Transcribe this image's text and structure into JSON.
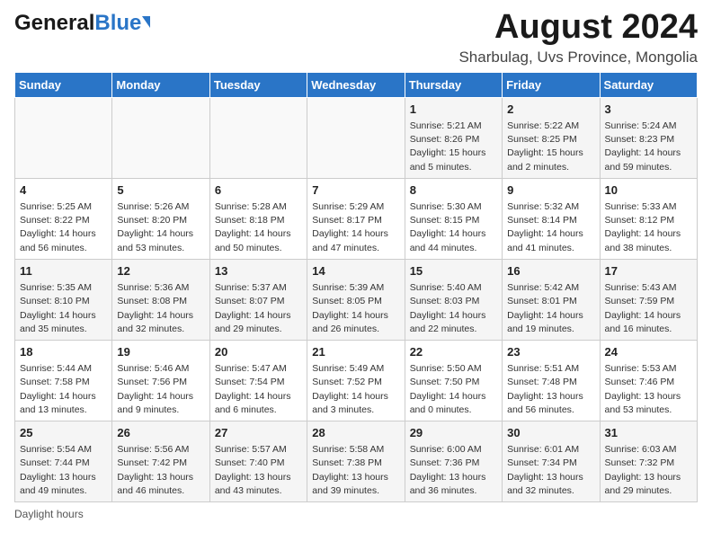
{
  "header": {
    "logo_general": "General",
    "logo_blue": "Blue",
    "title": "August 2024",
    "subtitle": "Sharbulag, Uvs Province, Mongolia"
  },
  "calendar": {
    "weekdays": [
      "Sunday",
      "Monday",
      "Tuesday",
      "Wednesday",
      "Thursday",
      "Friday",
      "Saturday"
    ],
    "weeks": [
      [
        {
          "day": "",
          "info": ""
        },
        {
          "day": "",
          "info": ""
        },
        {
          "day": "",
          "info": ""
        },
        {
          "day": "",
          "info": ""
        },
        {
          "day": "1",
          "info": "Sunrise: 5:21 AM\nSunset: 8:26 PM\nDaylight: 15 hours\nand 5 minutes."
        },
        {
          "day": "2",
          "info": "Sunrise: 5:22 AM\nSunset: 8:25 PM\nDaylight: 15 hours\nand 2 minutes."
        },
        {
          "day": "3",
          "info": "Sunrise: 5:24 AM\nSunset: 8:23 PM\nDaylight: 14 hours\nand 59 minutes."
        }
      ],
      [
        {
          "day": "4",
          "info": "Sunrise: 5:25 AM\nSunset: 8:22 PM\nDaylight: 14 hours\nand 56 minutes."
        },
        {
          "day": "5",
          "info": "Sunrise: 5:26 AM\nSunset: 8:20 PM\nDaylight: 14 hours\nand 53 minutes."
        },
        {
          "day": "6",
          "info": "Sunrise: 5:28 AM\nSunset: 8:18 PM\nDaylight: 14 hours\nand 50 minutes."
        },
        {
          "day": "7",
          "info": "Sunrise: 5:29 AM\nSunset: 8:17 PM\nDaylight: 14 hours\nand 47 minutes."
        },
        {
          "day": "8",
          "info": "Sunrise: 5:30 AM\nSunset: 8:15 PM\nDaylight: 14 hours\nand 44 minutes."
        },
        {
          "day": "9",
          "info": "Sunrise: 5:32 AM\nSunset: 8:14 PM\nDaylight: 14 hours\nand 41 minutes."
        },
        {
          "day": "10",
          "info": "Sunrise: 5:33 AM\nSunset: 8:12 PM\nDaylight: 14 hours\nand 38 minutes."
        }
      ],
      [
        {
          "day": "11",
          "info": "Sunrise: 5:35 AM\nSunset: 8:10 PM\nDaylight: 14 hours\nand 35 minutes."
        },
        {
          "day": "12",
          "info": "Sunrise: 5:36 AM\nSunset: 8:08 PM\nDaylight: 14 hours\nand 32 minutes."
        },
        {
          "day": "13",
          "info": "Sunrise: 5:37 AM\nSunset: 8:07 PM\nDaylight: 14 hours\nand 29 minutes."
        },
        {
          "day": "14",
          "info": "Sunrise: 5:39 AM\nSunset: 8:05 PM\nDaylight: 14 hours\nand 26 minutes."
        },
        {
          "day": "15",
          "info": "Sunrise: 5:40 AM\nSunset: 8:03 PM\nDaylight: 14 hours\nand 22 minutes."
        },
        {
          "day": "16",
          "info": "Sunrise: 5:42 AM\nSunset: 8:01 PM\nDaylight: 14 hours\nand 19 minutes."
        },
        {
          "day": "17",
          "info": "Sunrise: 5:43 AM\nSunset: 7:59 PM\nDaylight: 14 hours\nand 16 minutes."
        }
      ],
      [
        {
          "day": "18",
          "info": "Sunrise: 5:44 AM\nSunset: 7:58 PM\nDaylight: 14 hours\nand 13 minutes."
        },
        {
          "day": "19",
          "info": "Sunrise: 5:46 AM\nSunset: 7:56 PM\nDaylight: 14 hours\nand 9 minutes."
        },
        {
          "day": "20",
          "info": "Sunrise: 5:47 AM\nSunset: 7:54 PM\nDaylight: 14 hours\nand 6 minutes."
        },
        {
          "day": "21",
          "info": "Sunrise: 5:49 AM\nSunset: 7:52 PM\nDaylight: 14 hours\nand 3 minutes."
        },
        {
          "day": "22",
          "info": "Sunrise: 5:50 AM\nSunset: 7:50 PM\nDaylight: 14 hours\nand 0 minutes."
        },
        {
          "day": "23",
          "info": "Sunrise: 5:51 AM\nSunset: 7:48 PM\nDaylight: 13 hours\nand 56 minutes."
        },
        {
          "day": "24",
          "info": "Sunrise: 5:53 AM\nSunset: 7:46 PM\nDaylight: 13 hours\nand 53 minutes."
        }
      ],
      [
        {
          "day": "25",
          "info": "Sunrise: 5:54 AM\nSunset: 7:44 PM\nDaylight: 13 hours\nand 49 minutes."
        },
        {
          "day": "26",
          "info": "Sunrise: 5:56 AM\nSunset: 7:42 PM\nDaylight: 13 hours\nand 46 minutes."
        },
        {
          "day": "27",
          "info": "Sunrise: 5:57 AM\nSunset: 7:40 PM\nDaylight: 13 hours\nand 43 minutes."
        },
        {
          "day": "28",
          "info": "Sunrise: 5:58 AM\nSunset: 7:38 PM\nDaylight: 13 hours\nand 39 minutes."
        },
        {
          "day": "29",
          "info": "Sunrise: 6:00 AM\nSunset: 7:36 PM\nDaylight: 13 hours\nand 36 minutes."
        },
        {
          "day": "30",
          "info": "Sunrise: 6:01 AM\nSunset: 7:34 PM\nDaylight: 13 hours\nand 32 minutes."
        },
        {
          "day": "31",
          "info": "Sunrise: 6:03 AM\nSunset: 7:32 PM\nDaylight: 13 hours\nand 29 minutes."
        }
      ]
    ]
  },
  "footer": {
    "daylight_label": "Daylight hours"
  }
}
